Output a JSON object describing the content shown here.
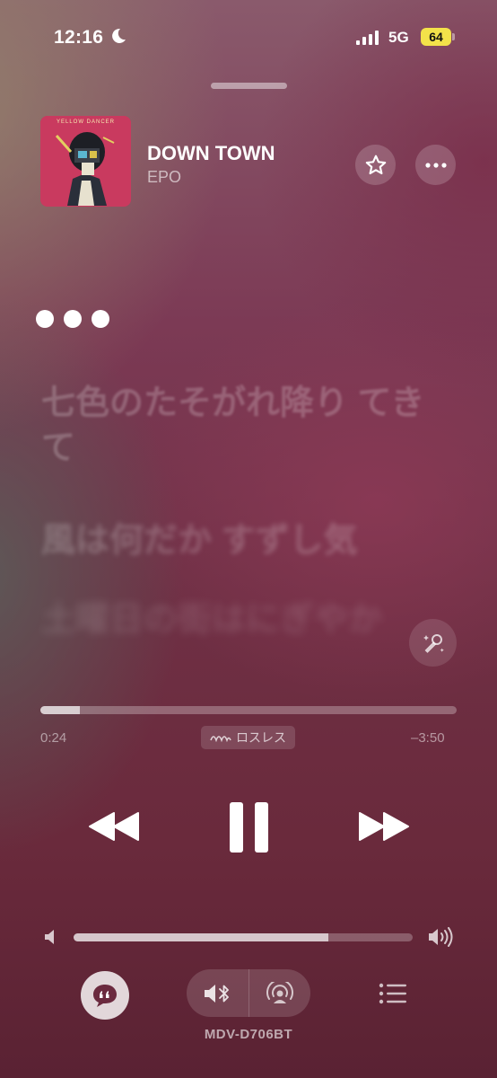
{
  "status_bar": {
    "time": "12:16",
    "network": "5G",
    "battery": "64"
  },
  "now_playing": {
    "title": "DOWN TOWN",
    "artist": "EPO",
    "album_art_text": "YELLOW DANCER"
  },
  "lyrics": {
    "lines": [
      "七色のたそがれ降り てきて",
      "風は何だか すずし気",
      "土曜日の街はにぎやか"
    ]
  },
  "progress": {
    "elapsed": "0:24",
    "remaining": "–3:50",
    "fraction": 0.094,
    "format_badge": "ロスレス"
  },
  "volume": {
    "fraction": 0.75
  },
  "output": {
    "device_name": "MDV-D706BT"
  },
  "icons": [
    "moon-icon",
    "signal-icon",
    "star-icon",
    "more-icon",
    "sing-mic-icon",
    "lossless-icon",
    "rewind-icon",
    "pause-icon",
    "fast-forward-icon",
    "volume-low-icon",
    "volume-high-icon",
    "lyrics-icon",
    "bluetooth-speaker-icon",
    "airplay-icon",
    "queue-icon"
  ]
}
